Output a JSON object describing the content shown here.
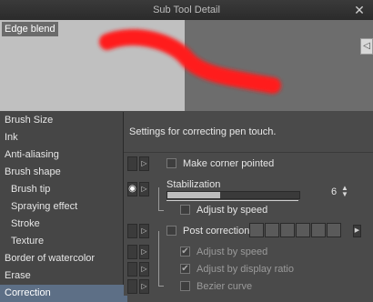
{
  "window": {
    "title": "Sub Tool Detail",
    "close_icon": "close-icon"
  },
  "preview": {
    "label": "Edge blend",
    "stroke_color": "#ff1a1a"
  },
  "sidebar": {
    "items": [
      {
        "label": "Brush Size"
      },
      {
        "label": "Ink"
      },
      {
        "label": "Anti-aliasing"
      },
      {
        "label": "Brush shape"
      },
      {
        "label": "Brush tip"
      },
      {
        "label": "Spraying effect"
      },
      {
        "label": "Stroke"
      },
      {
        "label": "Texture"
      },
      {
        "label": "Border of watercolor"
      },
      {
        "label": "Erase"
      },
      {
        "label": "Correction",
        "selected": true
      }
    ]
  },
  "settings": {
    "description": "Settings for correcting pen touch.",
    "make_corner_pointed": {
      "label": "Make corner pointed",
      "checked": false
    },
    "stabilization": {
      "label": "Stabilization",
      "value": "6",
      "level": 0.4
    },
    "adjust_by_speed": {
      "label": "Adjust by speed",
      "checked": false
    },
    "post_correction": {
      "label": "Post correction",
      "checked": false
    },
    "adjust_by_speed_2": {
      "label": "Adjust by speed",
      "checked": true
    },
    "adjust_by_display_ratio": {
      "label": "Adjust by display ratio",
      "checked": true
    },
    "bezier_curve": {
      "label": "Bezier curve",
      "checked": false
    }
  }
}
